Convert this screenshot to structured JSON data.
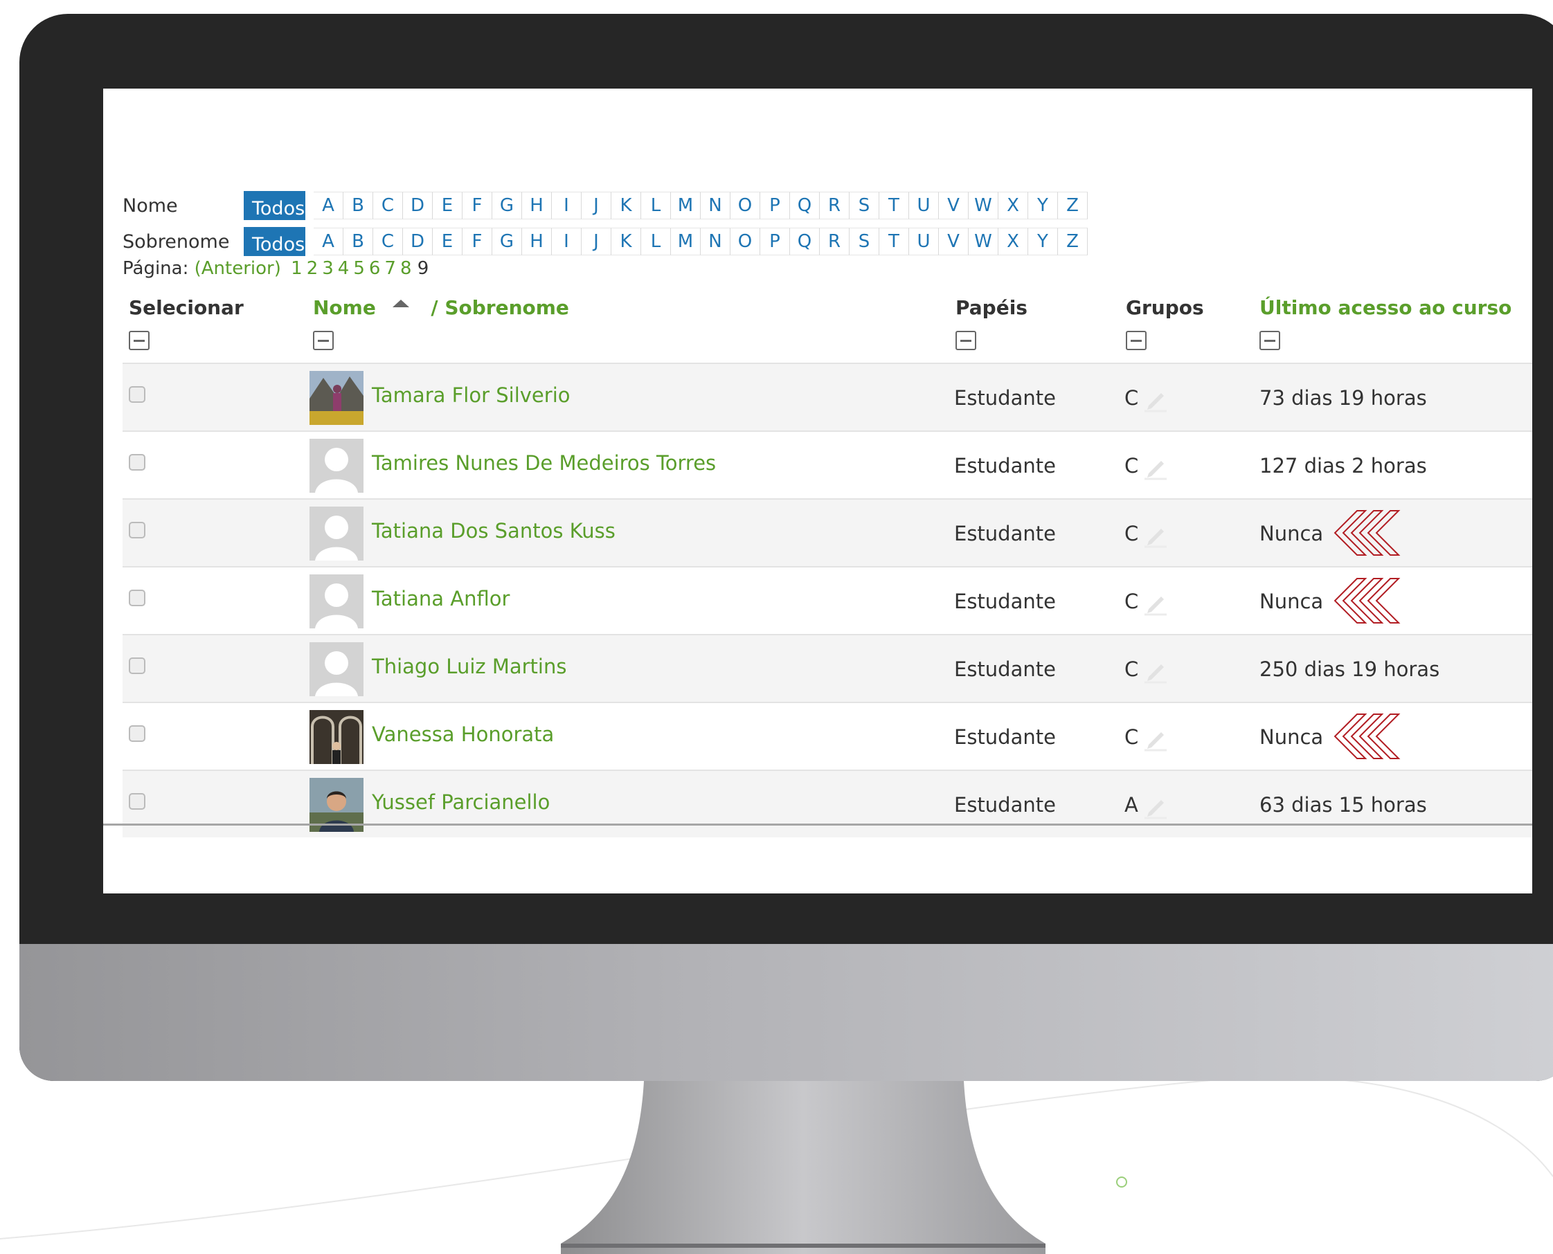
{
  "filters": {
    "first_name": {
      "label": "Nome",
      "all_label": "Todos"
    },
    "last_name": {
      "label": "Sobrenome",
      "all_label": "Todos"
    },
    "letters": [
      "A",
      "B",
      "C",
      "D",
      "E",
      "F",
      "G",
      "H",
      "I",
      "J",
      "K",
      "L",
      "M",
      "N",
      "O",
      "P",
      "Q",
      "R",
      "S",
      "T",
      "U",
      "V",
      "W",
      "X",
      "Y",
      "Z"
    ]
  },
  "pagination": {
    "label": "Página:",
    "prev_label": "(Anterior)",
    "pages": [
      "1",
      "2",
      "3",
      "4",
      "5",
      "6",
      "7",
      "8"
    ],
    "current": "9"
  },
  "table": {
    "headers": {
      "select": "Selecionar",
      "name": "Nome",
      "surname": "/ Sobrenome",
      "roles": "Papéis",
      "groups": "Grupos",
      "last_access": "Último acesso ao curso"
    },
    "rows": [
      {
        "name": "Tamara Flor Silverio",
        "role": "Estudante",
        "group": "C",
        "last_access": "73 dias 19 horas",
        "avatar": "photo-mountain",
        "flagged": false
      },
      {
        "name": "Tamires Nunes De Medeiros Torres",
        "role": "Estudante",
        "group": "C",
        "last_access": "127 dias 2 horas",
        "avatar": "default",
        "flagged": false
      },
      {
        "name": "Tatiana Dos Santos Kuss",
        "role": "Estudante",
        "group": "C",
        "last_access": "Nunca",
        "avatar": "default",
        "flagged": true
      },
      {
        "name": "Tatiana Anflor",
        "role": "Estudante",
        "group": "C",
        "last_access": "Nunca",
        "avatar": "default",
        "flagged": true
      },
      {
        "name": "Thiago Luiz Martins",
        "role": "Estudante",
        "group": "C",
        "last_access": "250 dias 19 horas",
        "avatar": "default",
        "flagged": false
      },
      {
        "name": "Vanessa Honorata",
        "role": "Estudante",
        "group": "C",
        "last_access": "Nunca",
        "avatar": "photo-arch",
        "flagged": true
      },
      {
        "name": "Yussef Parcianello",
        "role": "Estudante",
        "group": "A",
        "last_access": "63 dias 15 horas",
        "avatar": "photo-man",
        "flagged": false
      }
    ]
  },
  "colors": {
    "accent_blue": "#1e75b4",
    "link_green": "#5a9e2b",
    "flag_red": "#b21e24",
    "monitor_bezel": "#262626"
  }
}
